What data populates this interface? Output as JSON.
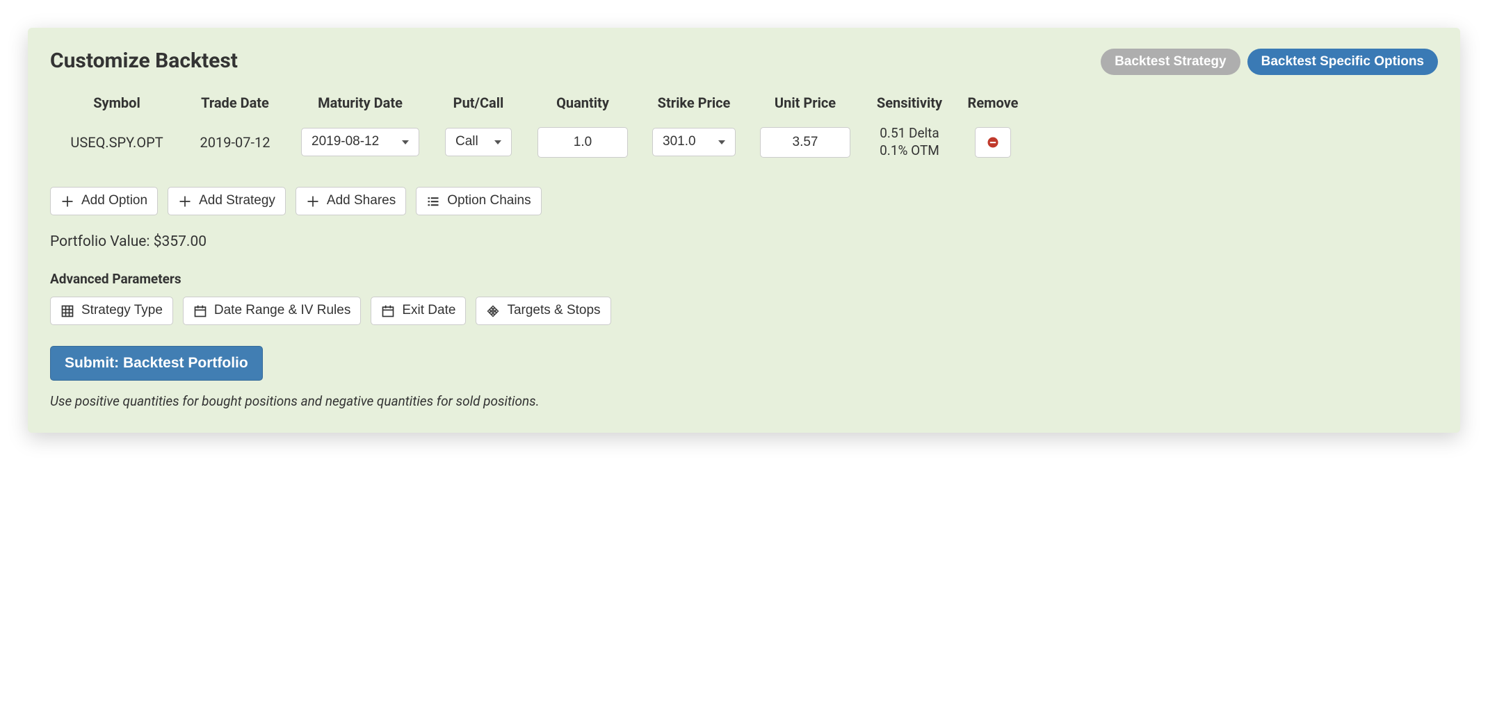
{
  "panel": {
    "title": "Customize Backtest",
    "tabs": {
      "strategy": "Backtest Strategy",
      "specific": "Backtest Specific Options"
    }
  },
  "table": {
    "headers": {
      "symbol": "Symbol",
      "trade_date": "Trade Date",
      "maturity_date": "Maturity Date",
      "put_call": "Put/Call",
      "quantity": "Quantity",
      "strike_price": "Strike Price",
      "unit_price": "Unit Price",
      "sensitivity": "Sensitivity",
      "remove": "Remove"
    },
    "rows": [
      {
        "symbol": "USEQ.SPY.OPT",
        "trade_date": "2019-07-12",
        "maturity_date": "2019-08-12",
        "put_call": "Call",
        "quantity": "1.0",
        "strike_price": "301.0",
        "unit_price": "3.57",
        "sensitivity_line1": "0.51 Delta",
        "sensitivity_line2": "0.1% OTM"
      }
    ]
  },
  "actions": {
    "add_option": "Add Option",
    "add_strategy": "Add Strategy",
    "add_shares": "Add Shares",
    "option_chains": "Option Chains"
  },
  "portfolio_value_label": "Portfolio Value: $357.00",
  "advanced": {
    "label": "Advanced Parameters",
    "strategy_type": "Strategy Type",
    "date_range": "Date Range & IV Rules",
    "exit_date": "Exit Date",
    "targets_stops": "Targets & Stops"
  },
  "submit_label": "Submit: Backtest Portfolio",
  "hint": "Use positive quantities for bought positions and negative quantities for sold positions."
}
